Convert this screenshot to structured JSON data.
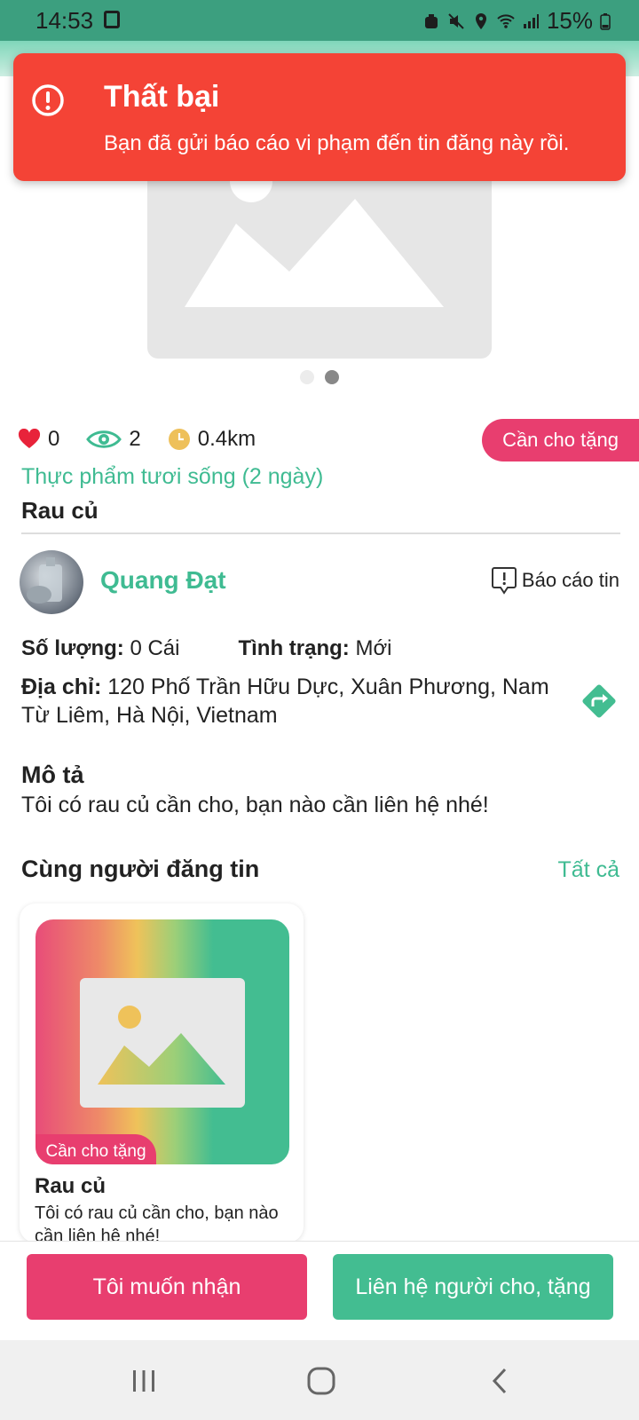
{
  "status_bar": {
    "time": "14:53",
    "battery": "15%"
  },
  "toast": {
    "title": "Thất bại",
    "message": "Bạn đã gửi báo cáo vi phạm đến tin đăng này rồi."
  },
  "stats": {
    "likes": "0",
    "views": "2",
    "distance": "0.4km"
  },
  "post": {
    "tag": "Cần cho tặng",
    "category": "Thực phẩm tươi sống (2 ngày)",
    "title": "Rau củ",
    "author": "Quang Đạt",
    "report_label": "Báo cáo tin",
    "quantity_label": "Số lượng:",
    "quantity_value": "0 Cái",
    "condition_label": "Tình trạng:",
    "condition_value": "Mới",
    "address_label": "Địa chỉ:",
    "address_value": "120 Phố Trần Hữu Dực, Xuân Phương, Nam Từ Liêm, Hà Nội, Vietnam",
    "description_label": "Mô tả",
    "description": "Tôi có rau củ cần cho, bạn nào cần liên hệ nhé!"
  },
  "same_poster": {
    "title": "Cùng người đăng tin",
    "see_all": "Tất cả",
    "items": [
      {
        "tag": "Cần cho tặng",
        "title": "Rau củ",
        "description": "Tôi có rau củ cần cho, bạn nào cần liên hệ nhé!"
      }
    ]
  },
  "actions": {
    "receive": "Tôi muốn nhận",
    "contact": "Liên hệ người cho, tặng"
  },
  "image_carousel": {
    "total": 2,
    "active_index": 1
  },
  "colors": {
    "primary_green": "#43bd91",
    "accent_pink": "#e83e6f",
    "error_red": "#f44336"
  }
}
